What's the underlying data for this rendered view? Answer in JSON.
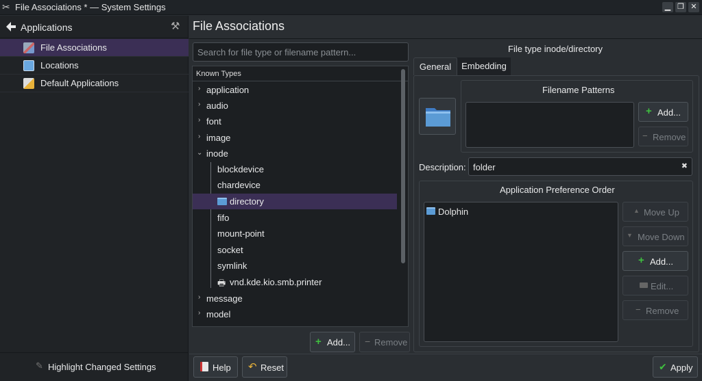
{
  "window": {
    "title": "File Associations * — System Settings",
    "minimize": "▁",
    "maximize": "❐",
    "close": "✕"
  },
  "sidebar": {
    "header": "Applications",
    "items": [
      {
        "label": "File Associations",
        "selected": true
      },
      {
        "label": "Locations",
        "selected": false
      },
      {
        "label": "Default Applications",
        "selected": false
      }
    ],
    "footer": "Highlight Changed Settings"
  },
  "page": {
    "title": "File Associations"
  },
  "search": {
    "placeholder": "Search for file type or filename pattern..."
  },
  "tree": {
    "header": "Known Types",
    "rows": [
      {
        "label": "application",
        "expanded": false,
        "level": 0
      },
      {
        "label": "audio",
        "expanded": false,
        "level": 0
      },
      {
        "label": "font",
        "expanded": false,
        "level": 0
      },
      {
        "label": "image",
        "expanded": false,
        "level": 0
      },
      {
        "label": "inode",
        "expanded": true,
        "level": 0
      },
      {
        "label": "blockdevice",
        "level": 1
      },
      {
        "label": "chardevice",
        "level": 1
      },
      {
        "label": "directory",
        "level": 1,
        "selected": true
      },
      {
        "label": "fifo",
        "level": 1
      },
      {
        "label": "mount-point",
        "level": 1
      },
      {
        "label": "socket",
        "level": 1
      },
      {
        "label": "symlink",
        "level": 1
      },
      {
        "label": "vnd.kde.kio.smb.printer",
        "level": 1
      },
      {
        "label": "message",
        "expanded": false,
        "level": 0
      },
      {
        "label": "model",
        "expanded": false,
        "level": 0
      }
    ]
  },
  "tree_buttons": {
    "add": "Add...",
    "remove": "Remove"
  },
  "details": {
    "heading": "File type inode/directory",
    "tabs": [
      "General",
      "Embedding"
    ],
    "active_tab": "General",
    "filename_patterns": {
      "title": "Filename Patterns",
      "add": "Add...",
      "remove": "Remove"
    },
    "description_label": "Description:",
    "description_value": "folder",
    "app_pref": {
      "title": "Application Preference Order",
      "apps": [
        "Dolphin"
      ],
      "move_up": "Move Up",
      "move_down": "Move Down",
      "add": "Add...",
      "edit": "Edit...",
      "remove": "Remove"
    }
  },
  "footer": {
    "help": "Help",
    "reset": "Reset",
    "apply": "Apply"
  },
  "colors": {
    "accent": "#3b2f55",
    "folder": "#5b9bd5",
    "add": "#3fbf3f"
  }
}
